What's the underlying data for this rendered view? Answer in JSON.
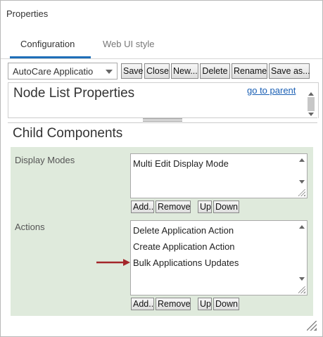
{
  "window": {
    "title": "Properties"
  },
  "tabs": [
    {
      "label": "Configuration",
      "active": true
    },
    {
      "label": "Web UI style",
      "active": false
    }
  ],
  "toolbar": {
    "component_select_value": "AutoCare Applicatio",
    "save": "Save",
    "close": "Close",
    "new": "New...",
    "delete": "Delete",
    "rename": "Rename",
    "save_as": "Save as..."
  },
  "node_list": {
    "title": "Node List Properties",
    "parent_link": "go to parent"
  },
  "child_components": {
    "title": "Child Components",
    "display_modes": {
      "label": "Display Modes",
      "items": [
        "Multi Edit Display Mode"
      ],
      "buttons": {
        "add": "Add..",
        "remove": "Remove",
        "up": "Up",
        "down": "Down"
      }
    },
    "actions": {
      "label": "Actions",
      "items": [
        "Delete Application Action",
        "Create Application Action",
        "Bulk Applications Updates"
      ],
      "buttons": {
        "add": "Add..",
        "remove": "Remove",
        "up": "Up",
        "down": "Down"
      }
    }
  },
  "colors": {
    "accent": "#1f6fb8",
    "panel_bg": "#dfeadc",
    "arrow": "#a3262a",
    "link": "#1a5fb4"
  }
}
